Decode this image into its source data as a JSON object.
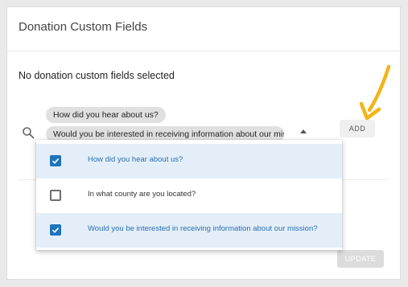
{
  "card": {
    "title": "Donation Custom Fields",
    "empty_message": "No donation custom fields selected"
  },
  "select": {
    "chips": [
      "How did you hear about us?",
      "Would you be interested in receiving information about our mission?"
    ]
  },
  "buttons": {
    "add_label": "ADD",
    "update_label": "UPDATE"
  },
  "dropdown": {
    "options": [
      {
        "label": "How did you hear about us?",
        "checked": true
      },
      {
        "label": "In what county are you located?",
        "checked": false
      },
      {
        "label": "Would you be interested in receiving information about our mission?",
        "checked": true
      }
    ]
  },
  "colors": {
    "accent": "#1e73be",
    "selected_row": "#e3eef8",
    "annotation_arrow": "#f2b417"
  },
  "icons": {
    "search": "search-icon",
    "caret": "caret-up-icon",
    "annotation": "arrow-annotation-icon",
    "checkbox_checked": "checkbox-checked-icon",
    "checkbox_unchecked": "checkbox-unchecked-icon"
  }
}
